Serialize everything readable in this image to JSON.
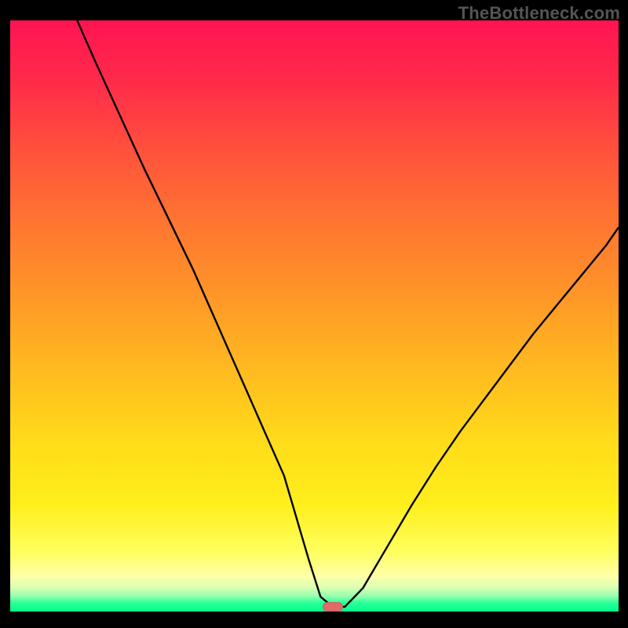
{
  "watermark": "TheBottleneck.com",
  "marker": {
    "x_pct": 53.0,
    "y_pct": 99.2
  },
  "chart_data": {
    "type": "line",
    "title": "",
    "xlabel": "",
    "ylabel": "",
    "xlim": [
      0,
      100
    ],
    "ylim": [
      0,
      100
    ],
    "grid": false,
    "legend": false,
    "series": [
      {
        "name": "bottleneck-curve",
        "x": [
          11,
          14,
          18,
          22,
          26,
          30,
          33,
          36,
          39,
          42,
          45,
          47,
          49,
          51,
          53,
          55,
          58,
          62,
          66,
          70,
          74,
          78,
          82,
          86,
          90,
          94,
          98,
          100
        ],
        "y": [
          100,
          93,
          84,
          75,
          66.5,
          58,
          51,
          44,
          37,
          30,
          23,
          16,
          9,
          2.5,
          0.8,
          0.8,
          4,
          11,
          18,
          24.5,
          30.5,
          36,
          41.5,
          47,
          52,
          57,
          62,
          65
        ]
      }
    ],
    "background_gradient": {
      "orientation": "vertical",
      "stops": [
        {
          "pos": 0,
          "color": "#ff1452"
        },
        {
          "pos": 0.1,
          "color": "#ff2a4a"
        },
        {
          "pos": 0.22,
          "color": "#ff513c"
        },
        {
          "pos": 0.32,
          "color": "#ff6f33"
        },
        {
          "pos": 0.42,
          "color": "#ff8a2b"
        },
        {
          "pos": 0.52,
          "color": "#ffa624"
        },
        {
          "pos": 0.62,
          "color": "#ffc21e"
        },
        {
          "pos": 0.72,
          "color": "#ffdd1a"
        },
        {
          "pos": 0.82,
          "color": "#ffef1c"
        },
        {
          "pos": 0.9,
          "color": "#ffff60"
        },
        {
          "pos": 0.94,
          "color": "#ffffa8"
        },
        {
          "pos": 0.96,
          "color": "#d8ffb3"
        },
        {
          "pos": 0.975,
          "color": "#8effad"
        },
        {
          "pos": 0.985,
          "color": "#2bff98"
        },
        {
          "pos": 1.0,
          "color": "#00ff8c"
        }
      ]
    },
    "marker_color": "#e26a6a",
    "curve_color": "#000000"
  }
}
